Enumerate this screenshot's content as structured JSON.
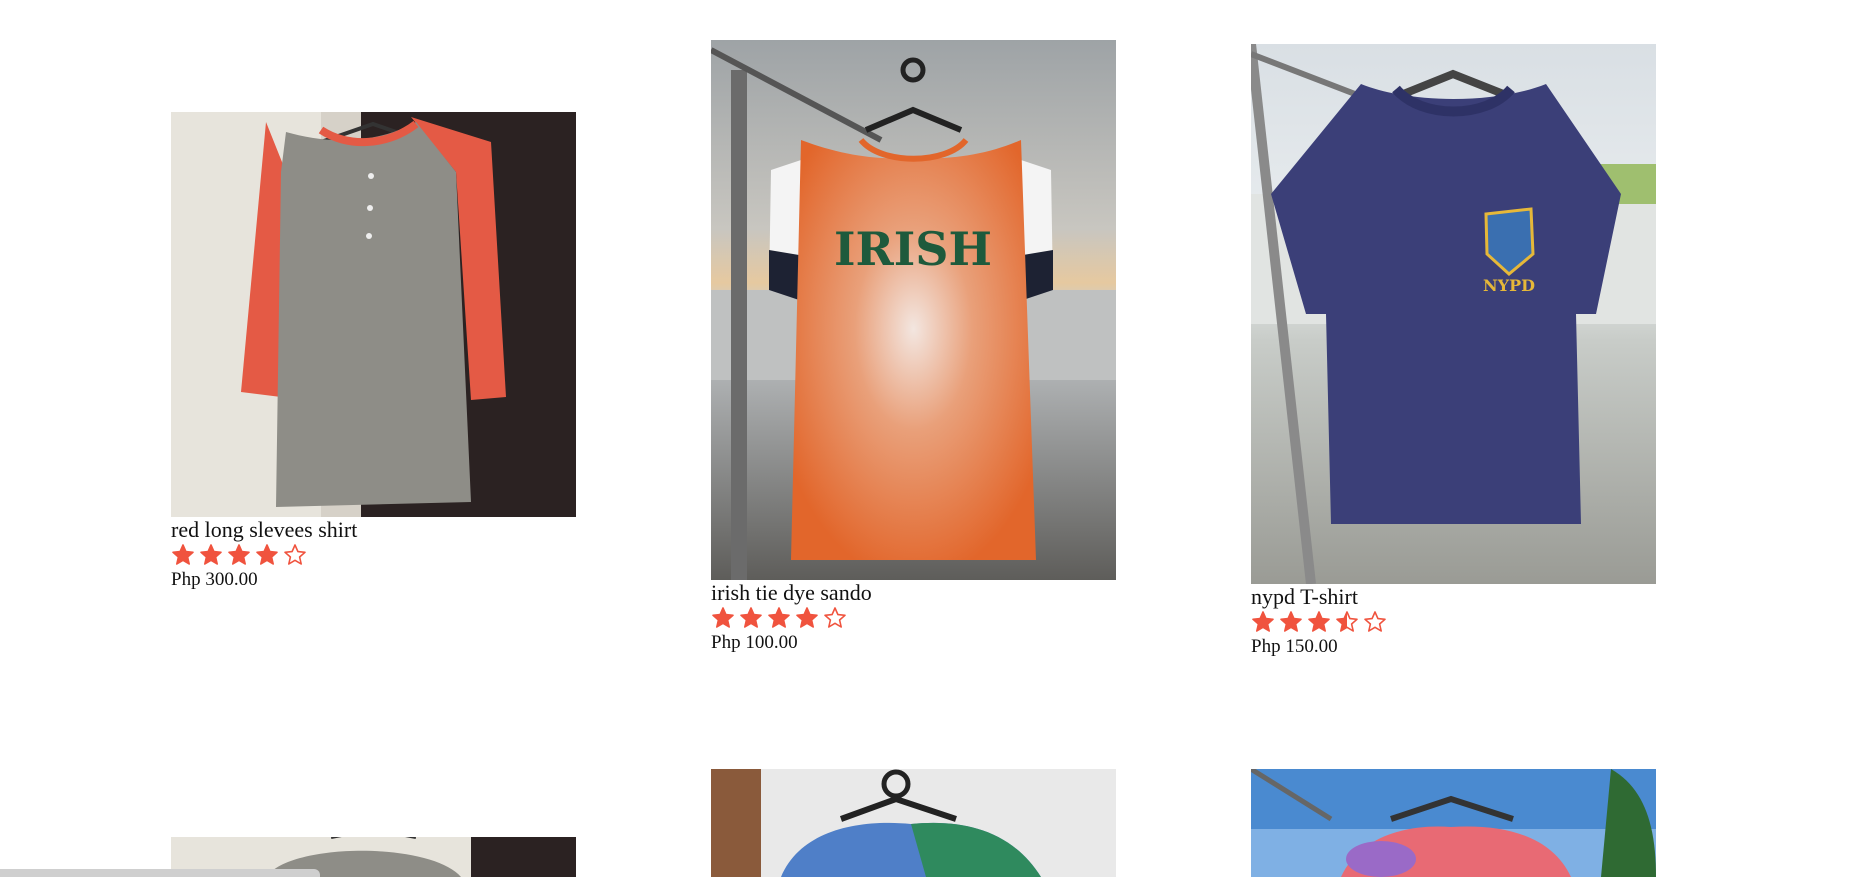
{
  "products": [
    {
      "name": "red long slevees shirt",
      "price": "Php 300.00",
      "rating": 4,
      "photo_icon": "raglan-shirt-photo"
    },
    {
      "name": "irish tie dye sando",
      "price": "Php 100.00",
      "rating": 4,
      "photo_icon": "tank-top-photo",
      "print_text": "IRISH"
    },
    {
      "name": "nypd T-shirt",
      "price": "Php 150.00",
      "rating": 3.5,
      "photo_icon": "tshirt-photo",
      "print_text": "NYPD"
    }
  ],
  "colors": {
    "star": "#f0533e",
    "text": "#111111"
  }
}
